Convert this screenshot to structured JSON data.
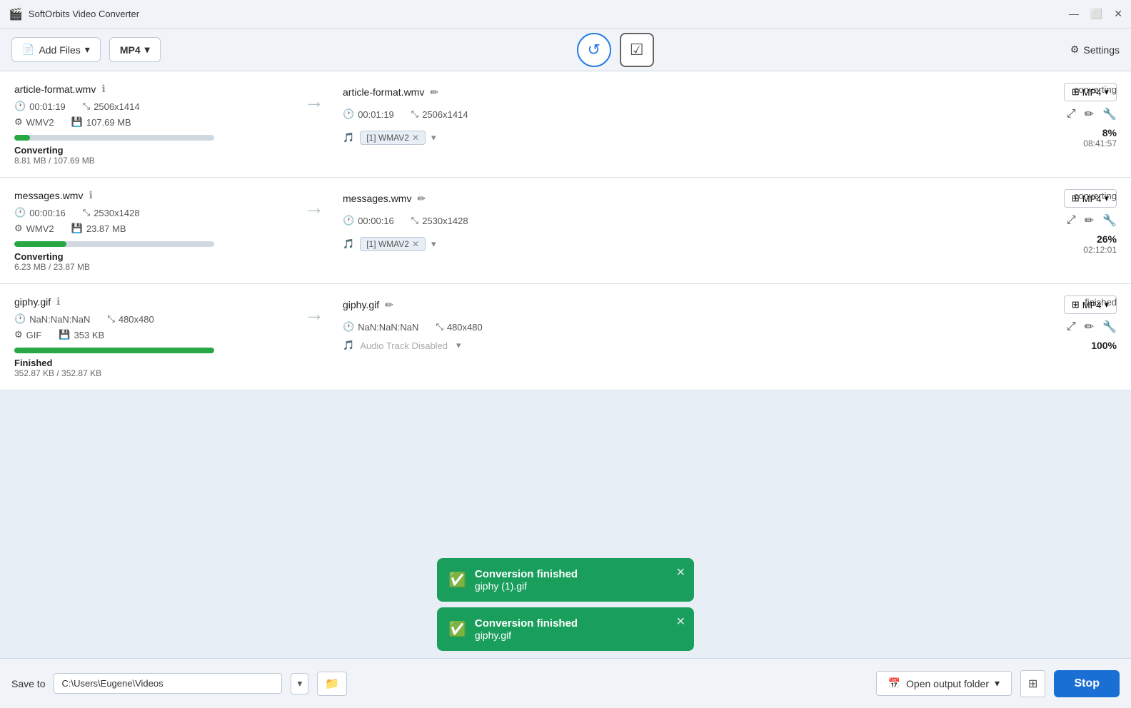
{
  "app": {
    "title": "SoftOrbits Video Converter",
    "icon": "🎬"
  },
  "titlebar": {
    "title": "SoftOrbits Video Converter",
    "controls": {
      "minimize": "—",
      "maximize": "⬜",
      "close": "✕"
    }
  },
  "toolbar": {
    "add_files_label": "Add Files",
    "format_label": "MP4",
    "settings_label": "Settings"
  },
  "files": [
    {
      "id": "file1",
      "source_name": "article-format.wmv",
      "source_duration": "00:01:19",
      "source_resolution": "2506x1414",
      "source_codec": "WMV2",
      "source_size": "107.69 MB",
      "target_name": "article-format.wmv",
      "target_duration": "00:01:19",
      "target_resolution": "2506x1414",
      "target_format": "MP4",
      "target_audio": "[1] WMAV2",
      "status": "converting",
      "progress_pct": 8,
      "progress_width": "8%",
      "progress_label": "Converting",
      "progress_sizes": "8.81 MB / 107.69 MB",
      "time_remaining": "08:41:57",
      "percent_display": "8%"
    },
    {
      "id": "file2",
      "source_name": "messages.wmv",
      "source_duration": "00:00:16",
      "source_resolution": "2530x1428",
      "source_codec": "WMV2",
      "source_size": "23.87 MB",
      "target_name": "messages.wmv",
      "target_duration": "00:00:16",
      "target_resolution": "2530x1428",
      "target_format": "MP4",
      "target_audio": "[1] WMAV2",
      "status": "converting",
      "progress_pct": 26,
      "progress_width": "26%",
      "progress_label": "Converting",
      "progress_sizes": "6.23 MB / 23.87 MB",
      "time_remaining": "02:12:01",
      "percent_display": "26%"
    },
    {
      "id": "file3",
      "source_name": "giphy.gif",
      "source_duration": "NaN:NaN:NaN",
      "source_resolution": "480x480",
      "source_codec": "GIF",
      "source_size": "353 KB",
      "target_name": "giphy.gif",
      "target_duration": "NaN:NaN:NaN",
      "target_resolution": "480x480",
      "target_format": "MP4",
      "target_audio": "Audio Track Disabled",
      "status": "finished",
      "progress_pct": 100,
      "progress_width": "100%",
      "progress_label": "Finished",
      "progress_sizes": "352.87 KB / 352.87 KB",
      "time_remaining": "",
      "percent_display": "100%"
    }
  ],
  "toasts": [
    {
      "id": "toast1",
      "title": "Conversion finished",
      "filename": "giphy (1).gif"
    },
    {
      "id": "toast2",
      "title": "Conversion finished",
      "filename": "giphy.gif"
    }
  ],
  "bottom_bar": {
    "save_to_label": "Save to",
    "save_path": "C:\\Users\\Eugene\\Videos",
    "open_folder_label": "Open output folder",
    "stop_label": "Stop"
  }
}
